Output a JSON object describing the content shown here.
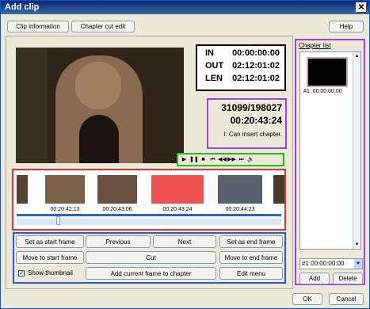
{
  "window": {
    "title": "Add clip"
  },
  "tabs": {
    "clip_information": "Clip information",
    "chapter_cut_edit": "Chapter cut edit"
  },
  "help": "Help",
  "timecodes": {
    "in_label": "IN",
    "in_value": "00:00:00:00",
    "out_label": "OUT",
    "out_value": "02:12:01:02",
    "len_label": "LEN",
    "len_value": "02:12:01:02"
  },
  "frame_info": {
    "frame_counter": "31099/198027",
    "current_time": "00:20:43:24",
    "status": "I: Can insert chapter."
  },
  "controls": [
    "play-icon",
    "pause-icon",
    "stop-icon",
    "prev-chapter-icon",
    "rewind-icon",
    "fast-forward-icon",
    "next-chapter-icon",
    "volume-icon"
  ],
  "thumbnails": [
    {
      "tc": "00:20:42:13",
      "color": "#7a6048"
    },
    {
      "tc": "00:20:43:06",
      "color": "#6a5040"
    },
    {
      "tc": "00:20:43:24",
      "color": "#f05050"
    },
    {
      "tc": "00:20:44:23",
      "color": "#5a6070"
    }
  ],
  "buttons": {
    "set_start": "Set as start frame",
    "previous": "Previous",
    "next": "Next",
    "set_end": "Set as end frame",
    "move_start": "Move to start frame",
    "cut": "Cut",
    "move_end": "Move to end frame",
    "show_thumbnail": "Show thumbnail",
    "add_current": "Add current frame to chapter",
    "edit_menu": "Edit menu"
  },
  "chapter": {
    "header": "Chapter list",
    "item_label": "#1: 00:00:00:00",
    "selected": "#1   00:00:00:00",
    "add": "Add",
    "delete": "Delete"
  },
  "footer": {
    "ok": "OK",
    "cancel": "Cancel"
  }
}
